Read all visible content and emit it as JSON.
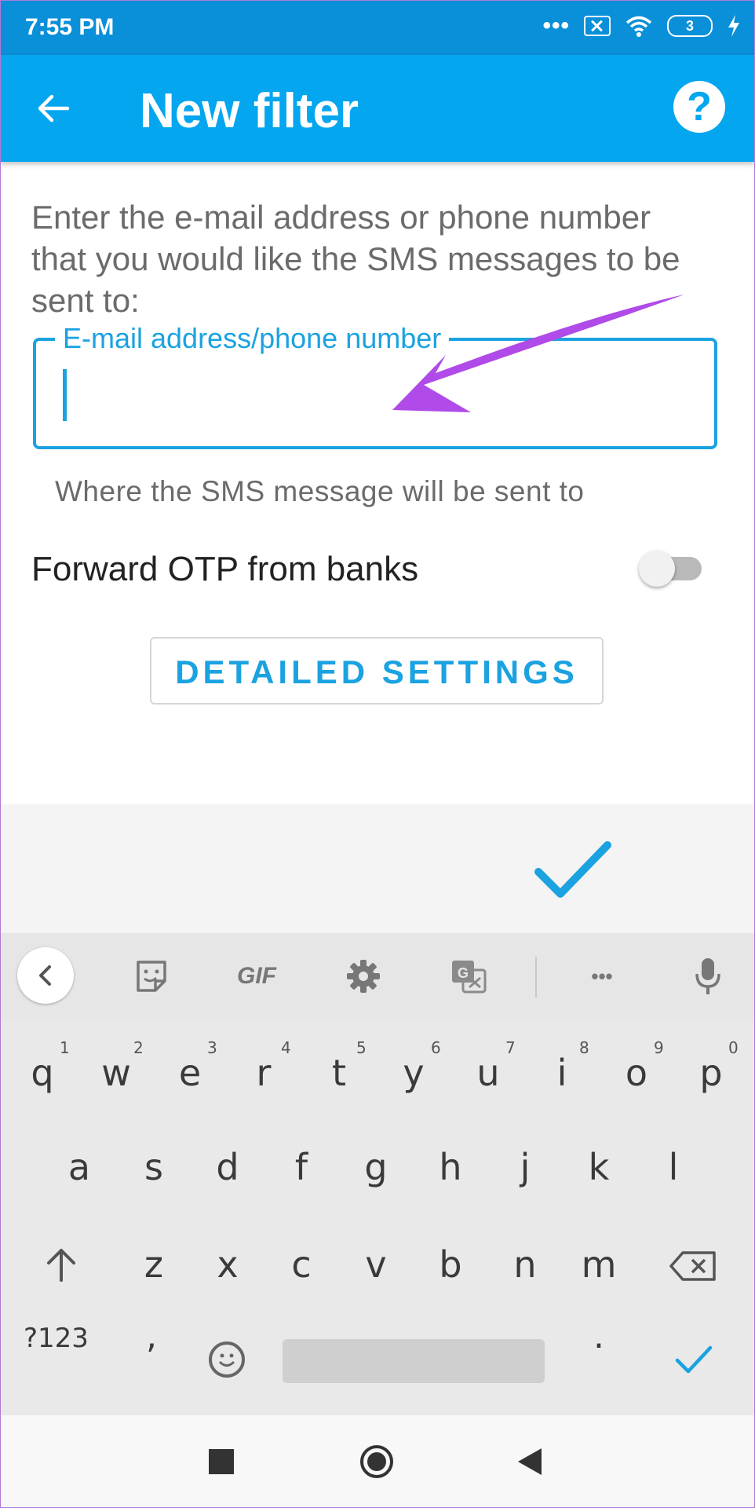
{
  "status_bar": {
    "time": "7:55 PM",
    "dots": "•••",
    "battery": "3"
  },
  "app_bar": {
    "title": "New filter",
    "back_icon": "arrow-left-icon",
    "help_icon": "help-circle-icon",
    "help_glyph": "?"
  },
  "form": {
    "instructions": "Enter the e-mail address or phone number that you would like the SMS messages to be sent to:",
    "recipient_field": {
      "label": "E-mail address/phone number",
      "value": ""
    },
    "helper_text": "Where the SMS message will be sent to",
    "otp_toggle": {
      "label": "Forward OTP from banks",
      "on": false
    },
    "detail_button_label": "DETAILED SETTINGS"
  },
  "keyboard": {
    "toolbar": {
      "gif_label": "GIF",
      "more_label": "•••"
    },
    "row1": [
      "q",
      "w",
      "e",
      "r",
      "t",
      "y",
      "u",
      "i",
      "o",
      "p"
    ],
    "row1_hints": [
      "1",
      "2",
      "3",
      "4",
      "5",
      "6",
      "7",
      "8",
      "9",
      "0"
    ],
    "row2": [
      "a",
      "s",
      "d",
      "f",
      "g",
      "h",
      "j",
      "k",
      "l"
    ],
    "row3": [
      "z",
      "x",
      "c",
      "v",
      "b",
      "n",
      "m"
    ],
    "sym_label": "?123",
    "comma": ",",
    "period": "."
  },
  "colors": {
    "accent": "#03a6ef",
    "status_bar": "#0a8fd9",
    "annotation_arrow": "#b04ae8"
  }
}
